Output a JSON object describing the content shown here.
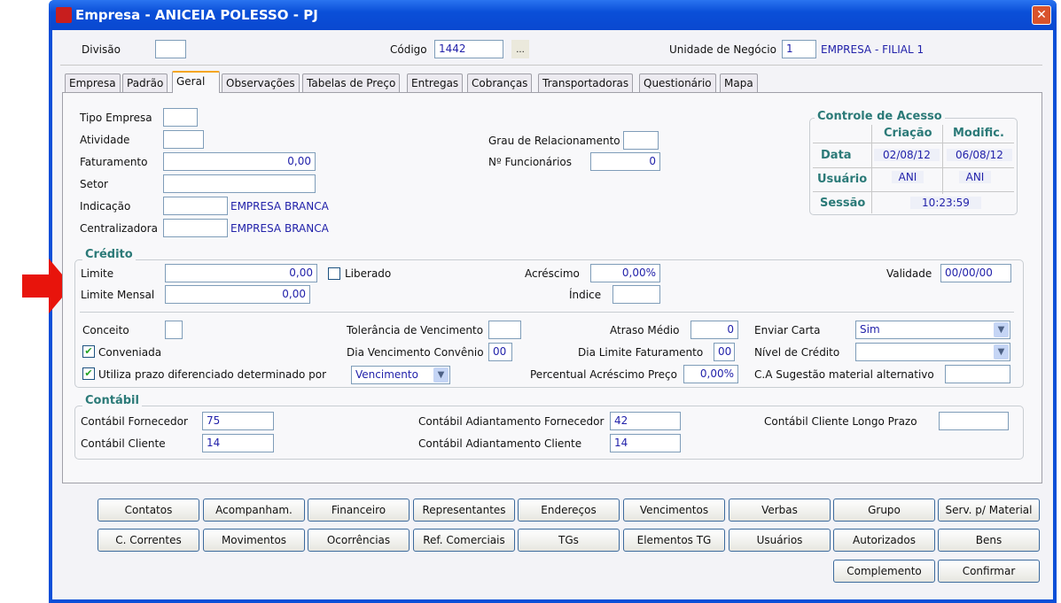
{
  "window": {
    "title": "Empresa - ANICEIA POLESSO - PJ",
    "close": "✕"
  },
  "header": {
    "divisao_label": "Divisão",
    "divisao": "",
    "codigo_label": "Código",
    "codigo": "1442",
    "lookup": "...",
    "unidade_label": "Unidade de Negócio",
    "unidade": "1",
    "unidade_nome": "EMPRESA - FILIAL 1"
  },
  "tabs": [
    "Empresa",
    "Padrão",
    "Geral",
    "Observações",
    "Tabelas de Preço",
    "Entregas",
    "Cobranças",
    "Transportadoras",
    "Questionário",
    "Mapa"
  ],
  "active_tab": "Geral",
  "geral": {
    "tipo_empresa_label": "Tipo Empresa",
    "atividade_label": "Atividade",
    "faturamento_label": "Faturamento",
    "faturamento": "0,00",
    "setor_label": "Setor",
    "indicacao_label": "Indicação",
    "indicacao_nome": "EMPRESA BRANCA",
    "centralizadora_label": "Centralizadora",
    "centralizadora_nome": "EMPRESA BRANCA",
    "grau_label": "Grau de Relacionamento",
    "funcionarios_label": "Nº Funcionários",
    "funcionarios": "0"
  },
  "controle": {
    "title": "Controle de Acesso",
    "col1": "Criação",
    "col2": "Modific.",
    "data_label": "Data",
    "data_criacao": "02/08/12",
    "data_modific": "06/08/12",
    "usuario_label": "Usuário",
    "usuario_criacao": "ANI",
    "usuario_modific": "ANI",
    "sessao_label": "Sessão",
    "sessao": "10:23:59"
  },
  "credito": {
    "title": "Crédito",
    "limite_label": "Limite",
    "limite": "0,00",
    "liberado_label": "Liberado",
    "liberado": false,
    "acrescimo_label": "Acréscimo",
    "acrescimo": "0,00%",
    "validade_label": "Validade",
    "validade": "00/00/00",
    "limite_mensal_label": "Limite Mensal",
    "limite_mensal": "0,00",
    "indice_label": "Índice",
    "conceito_label": "Conceito",
    "tolerancia_label": "Tolerância de Vencimento",
    "atraso_label": "Atraso Médio",
    "atraso": "0",
    "enviar_carta_label": "Enviar Carta",
    "enviar_carta": "Sim",
    "conveniada_label": "Conveniada",
    "conveniada": true,
    "dia_venc_label": "Dia Vencimento Convênio",
    "dia_venc": "00",
    "dia_limite_label": "Dia Limite Faturamento",
    "dia_limite": "00",
    "nivel_label": "Nível de Crédito",
    "nivel": "",
    "utiliza_label": "Utiliza prazo diferenciado determinado por",
    "utiliza": true,
    "utiliza_select": "Vencimento",
    "percentual_label": "Percentual Acréscimo Preço",
    "percentual": "0,00%",
    "ca_label": "C.A Sugestão material alternativo"
  },
  "contabil": {
    "title": "Contábil",
    "fornecedor_label": "Contábil Fornecedor",
    "fornecedor": "75",
    "cliente_label": "Contábil Cliente",
    "cliente": "14",
    "adiant_forn_label": "Contábil Adiantamento Fornecedor",
    "adiant_forn": "42",
    "adiant_cli_label": "Contábil Adiantamento Cliente",
    "adiant_cli": "14",
    "longo_label": "Contábil Cliente Longo Prazo"
  },
  "buttons": {
    "row1": [
      "Contatos",
      "Acompanham.",
      "Financeiro",
      "Representantes",
      "Endereços",
      "Vencimentos",
      "Verbas",
      "Grupo",
      "Serv. p/ Material"
    ],
    "row2": [
      "C. Correntes",
      "Movimentos",
      "Ocorrências",
      "Ref. Comerciais",
      "TGs",
      "Elementos TG",
      "Usuários",
      "Autorizados",
      "Bens"
    ],
    "row3": [
      "Complemento",
      "Confirmar"
    ]
  },
  "colors": {
    "title_bar": "#0a4fd8",
    "accent_text": "#2222aa",
    "group_title": "#2b7a78",
    "arrow": "#e8140c"
  }
}
